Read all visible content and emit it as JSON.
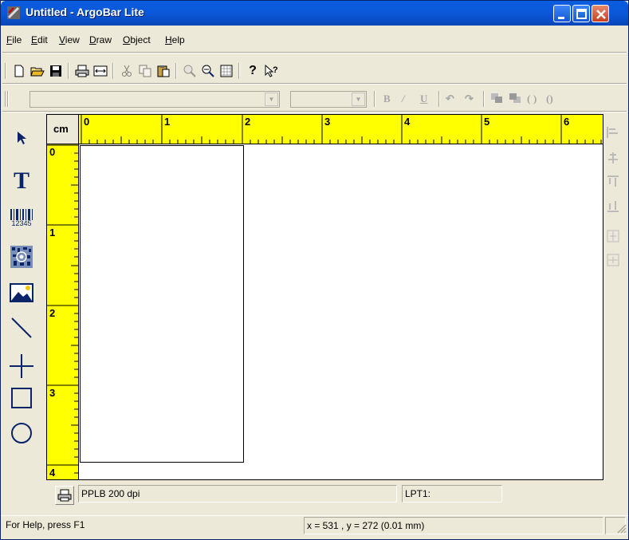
{
  "window": {
    "title": "Untitled - ArgoBar Lite"
  },
  "menu": [
    "File",
    "Edit",
    "View",
    "Draw",
    "Object",
    "Help"
  ],
  "toolbar": {
    "icons": [
      "new-icon",
      "open-icon",
      "save-icon",
      "print-icon",
      "print-preview-icon",
      "cut-icon",
      "copy-icon",
      "paste-icon",
      "zoom-in-icon",
      "zoom-out-icon",
      "grid-icon",
      "help-icon",
      "context-help-icon"
    ]
  },
  "format_toolbar": {
    "font_combo_value": "",
    "size_combo_value": "",
    "bold": "B",
    "italic": "/",
    "underline": "U"
  },
  "ruler": {
    "unit": "cm",
    "h_labels": [
      "0",
      "1",
      "2",
      "3",
      "4",
      "5",
      "6"
    ],
    "v_labels": [
      "0",
      "1",
      "2",
      "3",
      "4"
    ]
  },
  "left_tools": [
    "select-arrow-icon",
    "text-tool-icon",
    "barcode-tool-icon",
    "2d-barcode-tool-icon",
    "image-tool-icon",
    "line-tool-icon",
    "crosshair-tool-icon",
    "rectangle-tool-icon",
    "ellipse-tool-icon"
  ],
  "left_tool_labels": {
    "text": "T",
    "barcode_digits": "12345"
  },
  "printer": {
    "driver": "PPLB 200 dpi",
    "port": "LPT1:"
  },
  "status": {
    "help": "For Help, press F1",
    "coords": "x = 531 , y = 272  (0.01 mm)"
  },
  "colors": {
    "ruler": "#ffff00",
    "titlebar": "#0a5ce0"
  }
}
